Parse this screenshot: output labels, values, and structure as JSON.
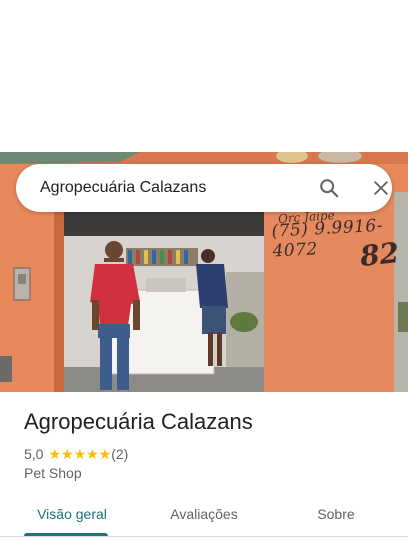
{
  "search": {
    "query": "Agropecuária Calazans"
  },
  "photo": {
    "wall_phone": "(75) 9.9916-4072",
    "wall_script": "Orç Jaipe",
    "wall_number": "82"
  },
  "place": {
    "title": "Agropecuária Calazans",
    "rating": "5,0",
    "stars": "★★★★★",
    "review_count": "(2)",
    "category": "Pet Shop"
  },
  "tabs": [
    {
      "label": "Visão geral",
      "active": true
    },
    {
      "label": "Avaliações",
      "active": false
    },
    {
      "label": "Sobre",
      "active": false
    }
  ],
  "colors": {
    "accent": "#1a737e",
    "star": "#fbbc04",
    "wall": "#e58a5e"
  },
  "icons": {
    "search": "search-icon",
    "close": "close-icon"
  }
}
